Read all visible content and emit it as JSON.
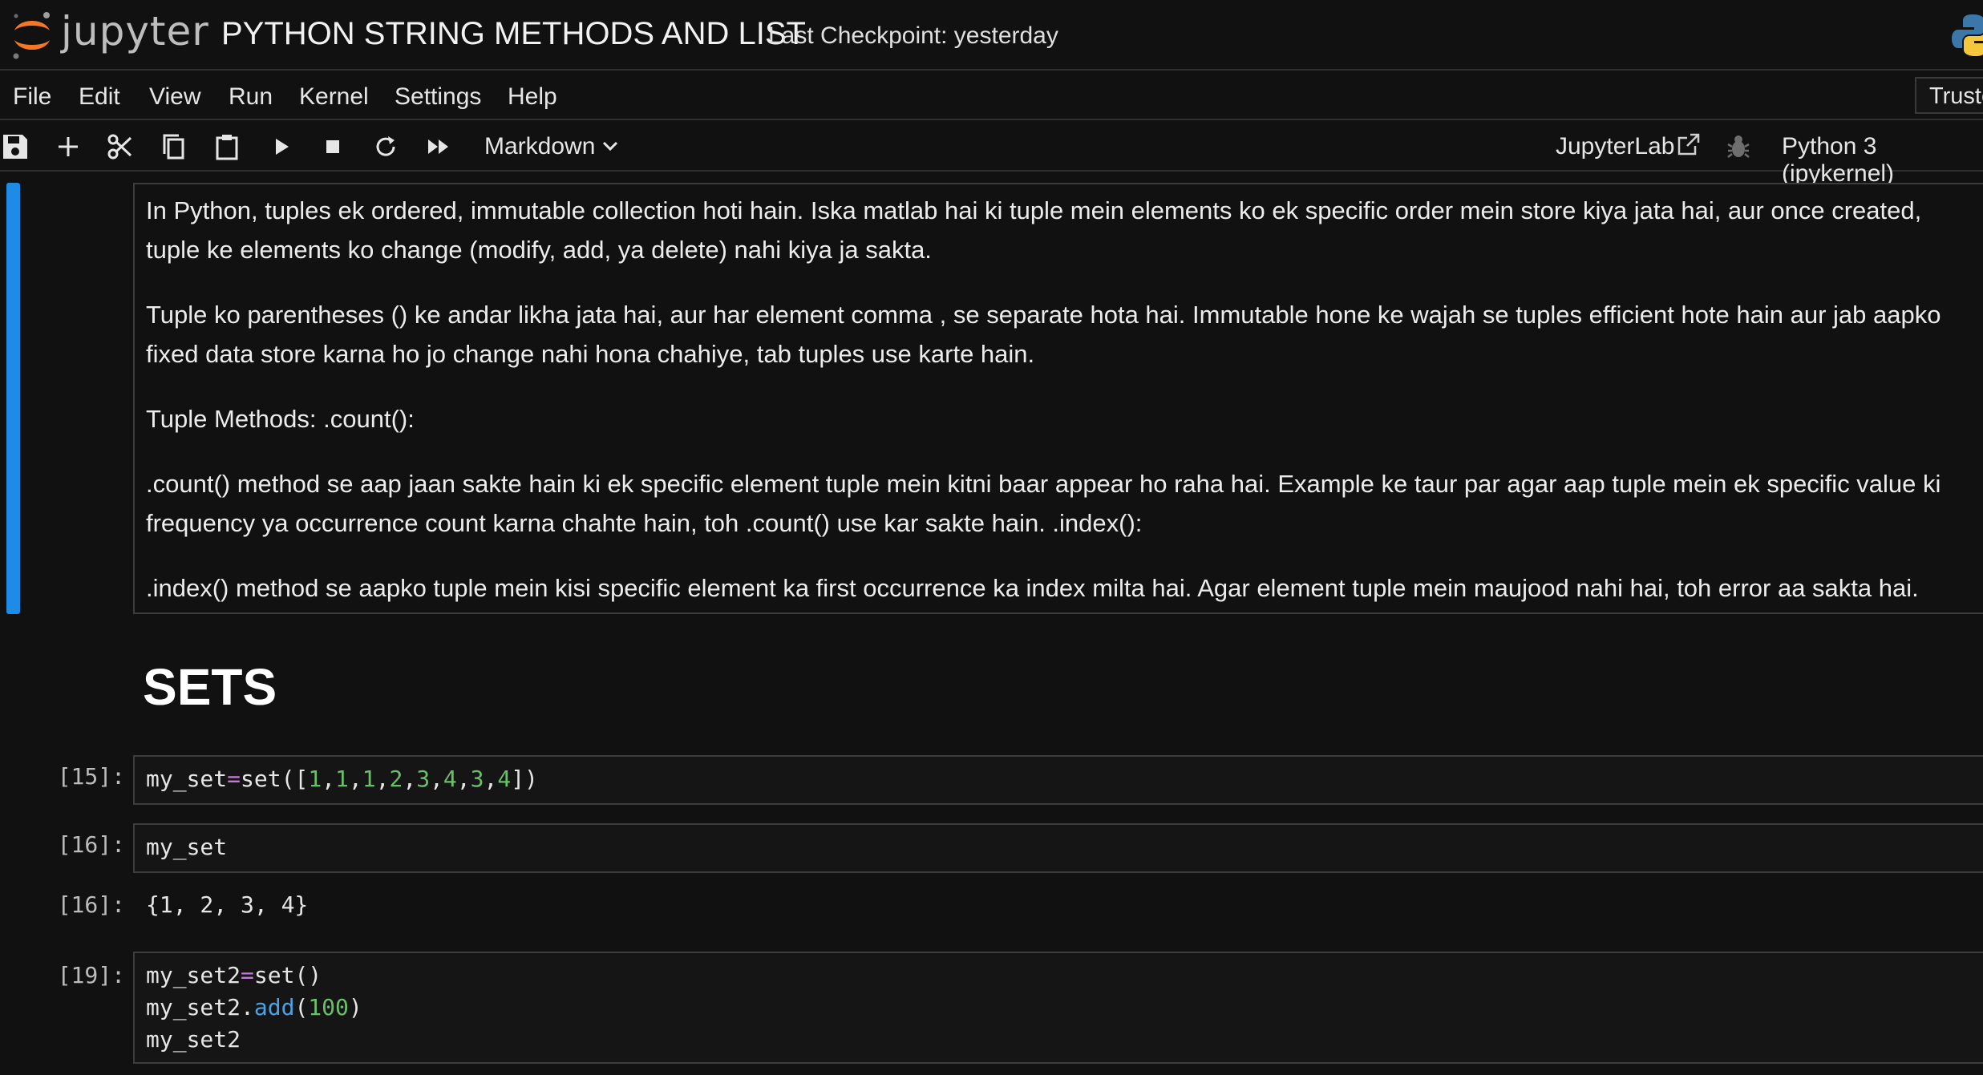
{
  "header": {
    "logo_text": "jupyter",
    "notebook_title": "PYTHON STRING METHODS AND LIST",
    "checkpoint": "Last Checkpoint: yesterday"
  },
  "menu": {
    "items": [
      "File",
      "Edit",
      "View",
      "Run",
      "Kernel",
      "Settings",
      "Help"
    ],
    "trusted": "Truste"
  },
  "toolbar": {
    "icons": [
      "save-icon",
      "add-icon",
      "cut-icon",
      "copy-icon",
      "paste-icon",
      "run-icon",
      "stop-icon",
      "restart-icon",
      "fast-forward-icon"
    ],
    "cell_type": "Markdown",
    "jupyterlab": "JupyterLab",
    "kernel": "Python 3 (ipykernel)"
  },
  "markdown_cell": {
    "paragraphs": [
      "In Python, tuples ek ordered, immutable collection hoti hain. Iska matlab hai ki tuple mein elements ko ek specific order mein store kiya jata hai, aur once created, tuple ke elements ko change (modify, add, ya delete) nahi kiya ja sakta.",
      "Tuple ko parentheses () ke andar likha jata hai, aur har element comma , se separate hota hai. Immutable hone ke wajah se tuples efficient hote hain aur jab aapko fixed data store karna ho jo change nahi hona chahiye, tab tuples use karte hain.",
      "Tuple Methods: .count():",
      ".count() method se aap jaan sakte hain ki ek specific element tuple mein kitni baar appear ho raha hai. Example ke taur par agar aap tuple mein ek specific value ki frequency ya occurrence count karna chahte hain, toh .count() use kar sakte hain. .index():",
      ".index() method se aapko tuple mein kisi specific element ka first occurrence ka index milta hai. Agar element tuple mein maujood nahi hai, toh error aa sakta hai."
    ]
  },
  "heading": "SETS",
  "cells": [
    {
      "prompt": "[15]:",
      "code_tokens": [
        [
          "my_set",
          ""
        ],
        [
          "=",
          "op"
        ],
        [
          "set([",
          ""
        ],
        [
          "1",
          "num"
        ],
        [
          ",",
          ""
        ],
        [
          "1",
          "num"
        ],
        [
          ",",
          ""
        ],
        [
          "1",
          "num"
        ],
        [
          ",",
          ""
        ],
        [
          "2",
          "num"
        ],
        [
          ",",
          ""
        ],
        [
          "3",
          "num"
        ],
        [
          ",",
          ""
        ],
        [
          "4",
          "num"
        ],
        [
          ",",
          ""
        ],
        [
          "3",
          "num"
        ],
        [
          ",",
          ""
        ],
        [
          "4",
          "num"
        ],
        [
          "])",
          ""
        ]
      ]
    },
    {
      "prompt": "[16]:",
      "code_tokens": [
        [
          "my_set",
          ""
        ]
      ],
      "output_prompt": "[16]:",
      "output": "{1, 2, 3, 4}"
    },
    {
      "prompt": "[19]:",
      "code_lines": [
        [
          [
            "my_set2",
            ""
          ],
          [
            "=",
            "op"
          ],
          [
            "set()",
            ""
          ]
        ],
        [
          [
            "my_set2.",
            ""
          ],
          [
            "add",
            "fn"
          ],
          [
            "(",
            ""
          ],
          [
            "100",
            "num"
          ],
          [
            ")",
            ""
          ]
        ],
        [
          [
            "my_set2",
            ""
          ]
        ]
      ]
    }
  ]
}
